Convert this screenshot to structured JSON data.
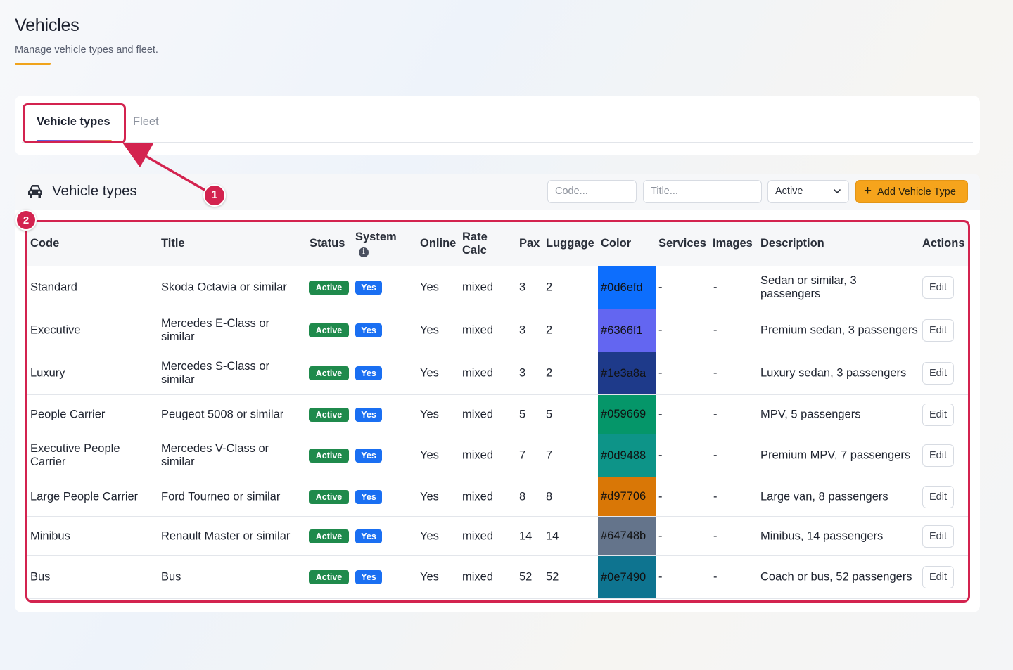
{
  "header": {
    "title": "Vehicles",
    "subtitle": "Manage vehicle types and fleet."
  },
  "tabs": [
    {
      "label": "Vehicle types",
      "active": true
    },
    {
      "label": "Fleet",
      "active": false
    }
  ],
  "callouts": [
    "1",
    "2"
  ],
  "card": {
    "icon": "car-icon",
    "title": "Vehicle types",
    "code_placeholder": "Code...",
    "title_placeholder": "Title...",
    "status_filter": "Active",
    "add_button": "Add Vehicle Type"
  },
  "table": {
    "headers": {
      "code": "Code",
      "title": "Title",
      "status": "Status",
      "system": "System",
      "online": "Online",
      "rate_calc": "Rate Calc",
      "pax": "Pax",
      "luggage": "Luggage",
      "color": "Color",
      "services": "Services",
      "images": "Images",
      "description": "Description",
      "actions": "Actions"
    },
    "rows": [
      {
        "code": "Standard",
        "title": "Skoda Octavia or similar",
        "status": "Active",
        "system": "Yes",
        "online": "Yes",
        "rate_calc": "mixed",
        "pax": "3",
        "luggage": "2",
        "color": "#0d6efd",
        "services": "-",
        "images": "-",
        "description": "Sedan or similar, 3 passengers",
        "action": "Edit"
      },
      {
        "code": "Executive",
        "title": "Mercedes E-Class or similar",
        "status": "Active",
        "system": "Yes",
        "online": "Yes",
        "rate_calc": "mixed",
        "pax": "3",
        "luggage": "2",
        "color": "#6366f1",
        "services": "-",
        "images": "-",
        "description": "Premium sedan, 3 passengers",
        "action": "Edit"
      },
      {
        "code": "Luxury",
        "title": "Mercedes S-Class or similar",
        "status": "Active",
        "system": "Yes",
        "online": "Yes",
        "rate_calc": "mixed",
        "pax": "3",
        "luggage": "2",
        "color": "#1e3a8a",
        "services": "-",
        "images": "-",
        "description": "Luxury sedan, 3 passengers",
        "action": "Edit"
      },
      {
        "code": "People Carrier",
        "title": "Peugeot 5008 or similar",
        "status": "Active",
        "system": "Yes",
        "online": "Yes",
        "rate_calc": "mixed",
        "pax": "5",
        "luggage": "5",
        "color": "#059669",
        "services": "-",
        "images": "-",
        "description": "MPV, 5 passengers",
        "action": "Edit"
      },
      {
        "code": "Executive People Carrier",
        "title": "Mercedes V-Class or similar",
        "status": "Active",
        "system": "Yes",
        "online": "Yes",
        "rate_calc": "mixed",
        "pax": "7",
        "luggage": "7",
        "color": "#0d9488",
        "services": "-",
        "images": "-",
        "description": "Premium MPV, 7 passengers",
        "action": "Edit"
      },
      {
        "code": "Large People Carrier",
        "title": "Ford Tourneo or similar",
        "status": "Active",
        "system": "Yes",
        "online": "Yes",
        "rate_calc": "mixed",
        "pax": "8",
        "luggage": "8",
        "color": "#d97706",
        "services": "-",
        "images": "-",
        "description": "Large van, 8 passengers",
        "action": "Edit"
      },
      {
        "code": "Minibus",
        "title": "Renault Master or similar",
        "status": "Active",
        "system": "Yes",
        "online": "Yes",
        "rate_calc": "mixed",
        "pax": "14",
        "luggage": "14",
        "color": "#64748b",
        "services": "-",
        "images": "-",
        "description": "Minibus, 14 passengers",
        "action": "Edit"
      },
      {
        "code": "Bus",
        "title": "Bus",
        "status": "Active",
        "system": "Yes",
        "online": "Yes",
        "rate_calc": "mixed",
        "pax": "52",
        "luggage": "52",
        "color": "#0e7490",
        "services": "-",
        "images": "-",
        "description": "Coach or bus, 52 passengers",
        "action": "Edit"
      }
    ]
  },
  "colors": {
    "accent": "#f0a31b",
    "callout": "#d3234f",
    "status_active": "#1f8a4c",
    "badge_yes": "#1a6ff2",
    "add_button": "#f6a41c"
  }
}
